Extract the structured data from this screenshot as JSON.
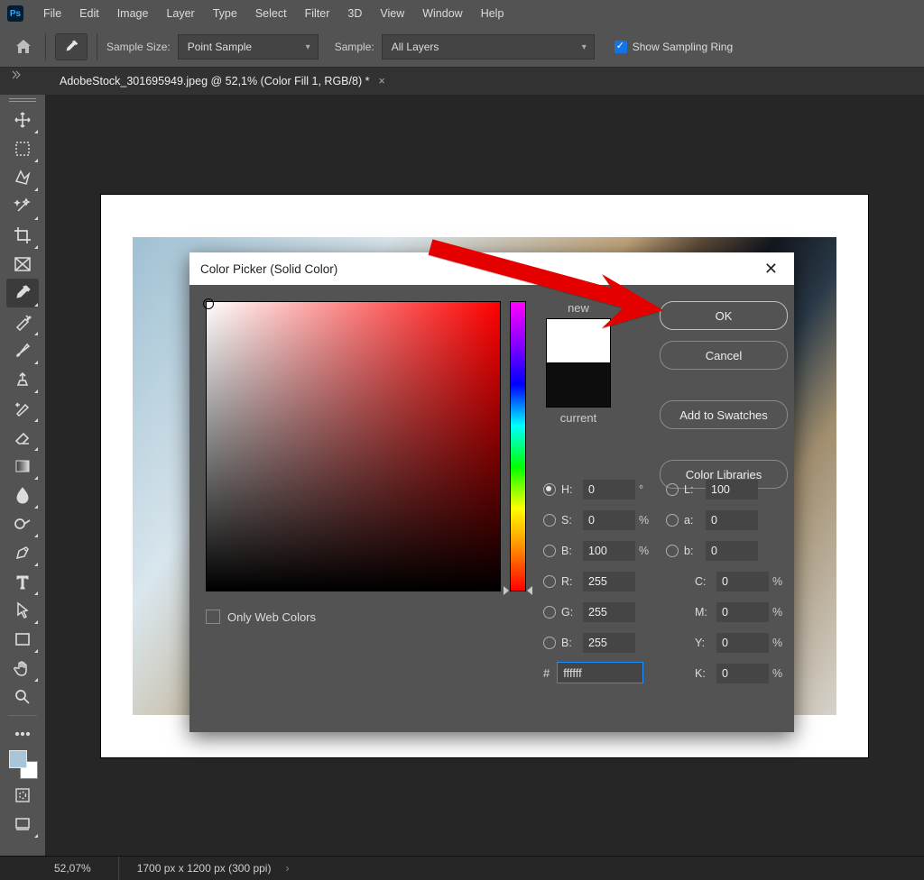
{
  "menu": {
    "items": [
      "File",
      "Edit",
      "Image",
      "Layer",
      "Type",
      "Select",
      "Filter",
      "3D",
      "View",
      "Window",
      "Help"
    ]
  },
  "options": {
    "sample_size_label": "Sample Size:",
    "sample_size_value": "Point Sample",
    "sample_label": "Sample:",
    "sample_value": "All Layers",
    "ring_label": "Show Sampling Ring"
  },
  "document": {
    "tab_title": "AdobeStock_301695949.jpeg @ 52,1% (Color Fill 1, RGB/8) *"
  },
  "dialog": {
    "title": "Color Picker (Solid Color)",
    "new_label": "new",
    "current_label": "current",
    "btn_ok": "OK",
    "btn_cancel": "Cancel",
    "btn_swatches": "Add to Swatches",
    "btn_libraries": "Color Libraries",
    "only_web": "Only Web Colors",
    "h": "H:",
    "s": "S:",
    "b": "B:",
    "r": "R:",
    "g": "G:",
    "bl": "B:",
    "l": "L:",
    "a": "a:",
    "bb": "b:",
    "c": "C:",
    "m": "M:",
    "y": "Y:",
    "k": "K:",
    "deg": "°",
    "pct": "%",
    "val_h": "0",
    "val_s": "0",
    "val_b": "100",
    "val_r": "255",
    "val_g": "255",
    "val_bl": "255",
    "val_l": "100",
    "val_a": "0",
    "val_bb": "0",
    "val_c": "0",
    "val_m": "0",
    "val_y": "0",
    "val_k": "0",
    "hex_label": "#",
    "hex_value": "ffffff",
    "new_color": "#ffffff",
    "current_color": "#0d0d0d"
  },
  "status": {
    "zoom": "52,07%",
    "dimensions": "1700 px x 1200 px (300 ppi)"
  }
}
